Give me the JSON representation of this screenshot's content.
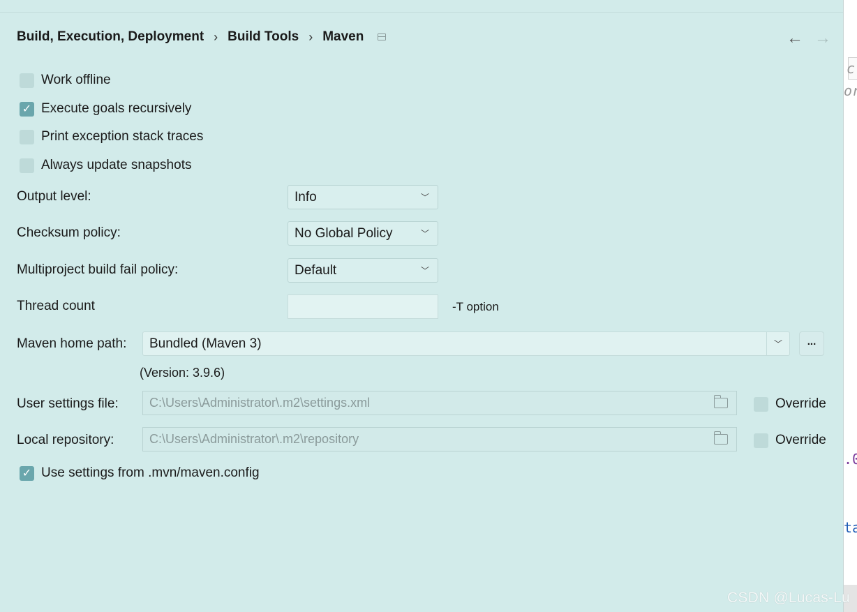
{
  "breadcrumb": {
    "items": [
      "Build, Execution, Deployment",
      "Build Tools",
      "Maven"
    ],
    "separator": "›"
  },
  "nav": {
    "back_icon": "←",
    "forward_icon": "→"
  },
  "checkboxes": {
    "work_offline": {
      "label": "Work offline",
      "checked": false
    },
    "execute_goals": {
      "label": "Execute goals recursively",
      "checked": true
    },
    "print_exception": {
      "label": "Print exception stack traces",
      "checked": false
    },
    "always_update": {
      "label": "Always update snapshots",
      "checked": false
    },
    "use_settings": {
      "label": "Use settings from .mvn/maven.config",
      "checked": true
    }
  },
  "output_level": {
    "label": "Output level:",
    "value": "Info"
  },
  "checksum_policy": {
    "label": "Checksum policy:",
    "value": "No Global Policy"
  },
  "multiproject_policy": {
    "label": "Multiproject build fail policy:",
    "value": "Default"
  },
  "thread_count": {
    "label": "Thread count",
    "value": "",
    "hint": "-T option"
  },
  "maven_home": {
    "label": "Maven home path:",
    "value": "Bundled (Maven 3)",
    "browse_label": "...",
    "version": "(Version: 3.9.6)"
  },
  "user_settings": {
    "label": "User settings file:",
    "value": "C:\\Users\\Administrator\\.m2\\settings.xml",
    "override_label": "Override",
    "override_checked": false
  },
  "local_repository": {
    "label": "Local repository:",
    "value": "C:\\Users\\Administrator\\.m2\\repository",
    "override_label": "Override",
    "override_checked": false
  },
  "editor_strip": {
    "fragments": [
      "c",
      "or",
      ".0",
      "ta"
    ]
  },
  "watermark": "CSDN @Lucas-Lu",
  "colors": {
    "background": "#d2ebea",
    "checkbox_checked": "#6aa6ac",
    "checkbox_unchecked": "#bedad9"
  }
}
